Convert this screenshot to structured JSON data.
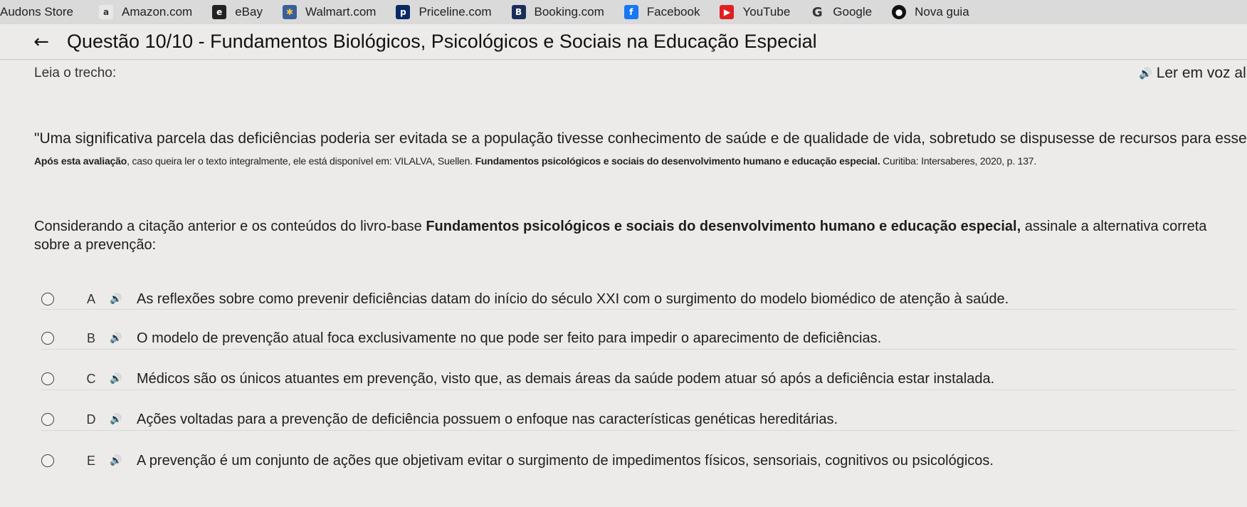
{
  "bookmarks": [
    {
      "label": "Audons Store",
      "icon": ""
    },
    {
      "label": "Amazon.com",
      "icon": "a"
    },
    {
      "label": "eBay",
      "icon": "e"
    },
    {
      "label": "Walmart.com",
      "icon": "✱"
    },
    {
      "label": "Priceline.com",
      "icon": "p"
    },
    {
      "label": "Booking.com",
      "icon": "B"
    },
    {
      "label": "Facebook",
      "icon": "f"
    },
    {
      "label": "YouTube",
      "icon": "▶"
    },
    {
      "label": "Google",
      "icon": "G"
    },
    {
      "label": "Nova guia",
      "icon": "●"
    }
  ],
  "header": {
    "back_icon": "←",
    "title": "Questão 10/10 - Fundamentos Biológicos, Psicológicos e Sociais na Educação Especial"
  },
  "prompt": {
    "leia": "Leia o trecho:",
    "tts_label": "Ler em voz al",
    "quote": "\"Uma significativa parcela das deficiências poderia ser evitada se a população tivesse conhecimento de saúde e de qualidade de vida, sobretudo se dispusesse de recursos para esse fim\".",
    "citation_bold_1": "Após esta avaliação",
    "citation_plain_1": ", caso queira ler o texto integralmente, ele está disponível em: VILALVA, Suellen. ",
    "citation_bold_2": "Fundamentos psicológicos e sociais do desenvolvimento humano e educação especial.",
    "citation_plain_2": " Curitiba: Intersaberes, 2020, p. 137.",
    "question_plain_1": "Considerando a citação anterior e os conteúdos do livro-base ",
    "question_bold": "Fundamentos psicológicos e sociais do desenvolvimento humano e educação especial,",
    "question_plain_2": " assinale a alternativa correta sobre a prevenção:"
  },
  "options": [
    {
      "letter": "A",
      "text": "As reflexões sobre como prevenir deficiências datam do início do século XXI com o surgimento do modelo biomédico de atenção à saúde."
    },
    {
      "letter": "B",
      "text": "O modelo de prevenção atual foca exclusivamente no que pode ser feito para impedir o aparecimento de deficiências."
    },
    {
      "letter": "C",
      "text": "Médicos são os únicos atuantes em prevenção, visto que, as demais áreas da saúde podem atuar só após a deficiência estar instalada."
    },
    {
      "letter": "D",
      "text": "Ações voltadas para a prevenção de deficiência possuem o enfoque nas características genéticas hereditárias."
    },
    {
      "letter": "E",
      "text": "A prevenção é um conjunto de ações que objetivam evitar o surgimento de impedimentos físicos, sensoriais, cognitivos ou psicológicos."
    }
  ],
  "icons": {
    "speaker": "🔊"
  }
}
